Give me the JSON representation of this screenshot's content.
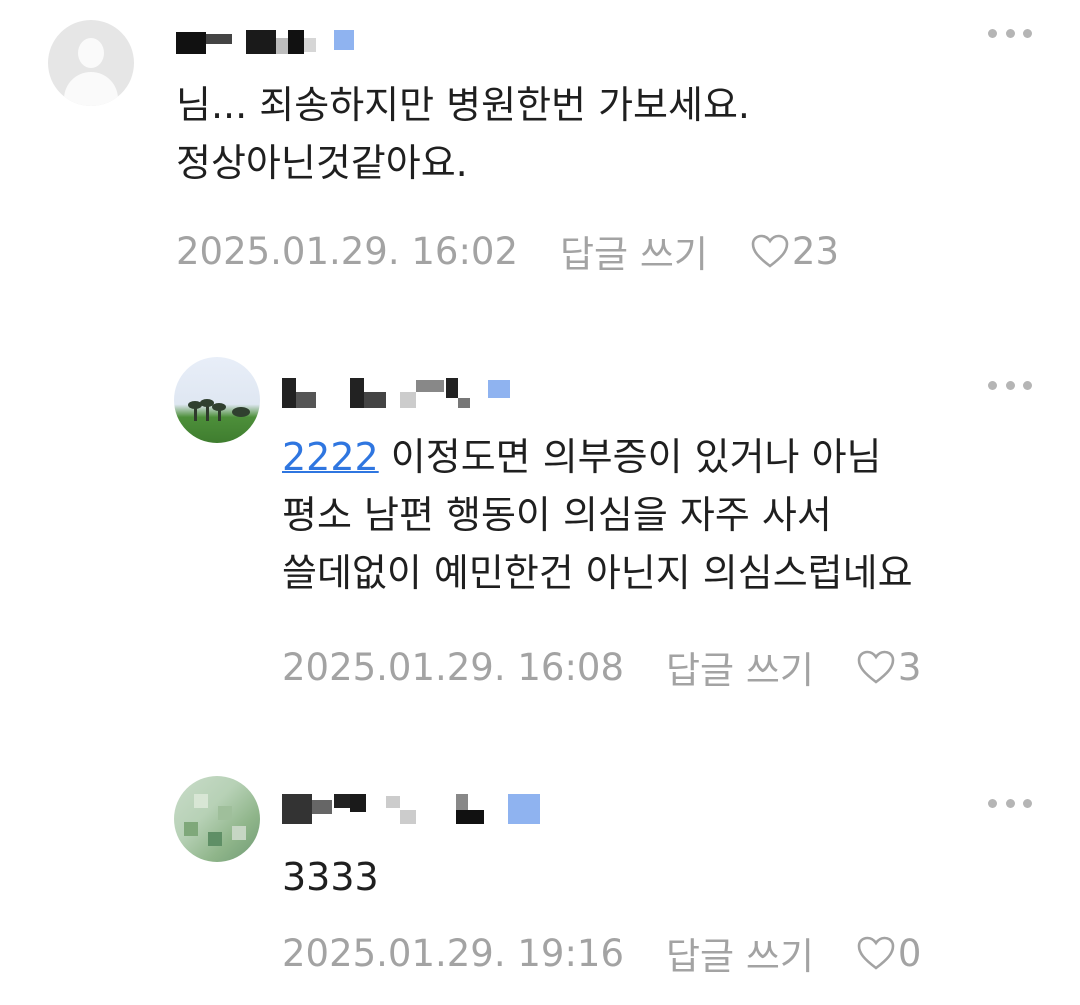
{
  "comments": [
    {
      "text": "님... 죄송하지만 병원한번 가보세요.\n정상아닌것같아요.",
      "date": "2025.01.29. 16:02",
      "reply_label": "답글 쓰기",
      "likes": "23"
    },
    {
      "mention": "2222",
      "text": " 이정도면 의부증이 있거나 아님\n평소 남편 행동이 의심을 자주 사서\n쓸데없이 예민한건 아닌지 의심스럽네요",
      "date": "2025.01.29. 16:08",
      "reply_label": "답글 쓰기",
      "likes": "3"
    },
    {
      "text": "3333",
      "date": "2025.01.29. 19:16",
      "reply_label": "답글 쓰기",
      "likes": "0"
    }
  ],
  "icons": {
    "more": "more-dots-icon",
    "like": "heart-outline-icon"
  },
  "colors": {
    "mention": "#2f76e0",
    "meta": "#a3a3a3",
    "badge": "#8fb3f0"
  }
}
